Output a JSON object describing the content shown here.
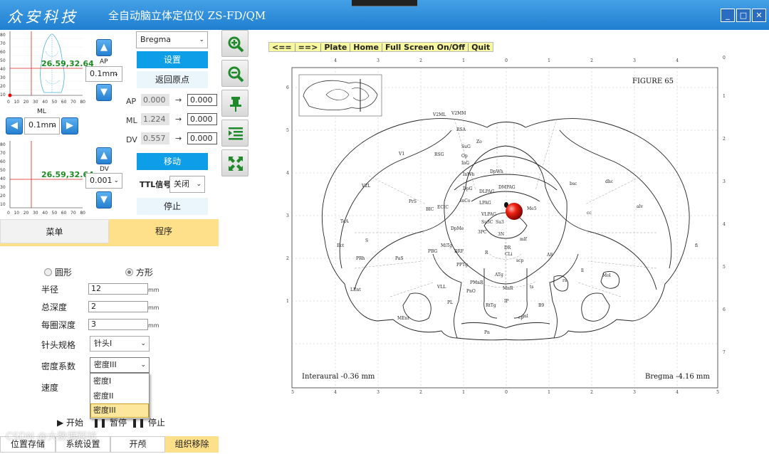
{
  "window": {
    "brand": "众安科技",
    "title": "全自动脑立体定位仪 ZS-FD/QM",
    "controls": {
      "minimize": "_",
      "maximize": "□",
      "close": "✕"
    }
  },
  "plot_top": {
    "coord": "26.59,32.64",
    "xlabel": "ML",
    "yticks": [
      "80",
      "70",
      "60",
      "50",
      "40",
      "30",
      "20",
      "10",
      "0"
    ],
    "xticks": [
      "0",
      "10",
      "20",
      "30",
      "40",
      "50",
      "60",
      "70",
      "80"
    ]
  },
  "plot_bottom": {
    "coord": "26.59,32.64",
    "yticks": [
      "80",
      "70",
      "60",
      "50",
      "40",
      "30",
      "20",
      "10",
      "0"
    ],
    "xticks": [
      "0",
      "10",
      "20",
      "30",
      "40",
      "50",
      "60",
      "70",
      "80"
    ]
  },
  "ap": {
    "label": "AP",
    "step": "0.1mm"
  },
  "ml": {
    "step": "0.1mm"
  },
  "dv": {
    "label": "DV",
    "step": "0.001"
  },
  "reference": {
    "value": "Bregma"
  },
  "buttons": {
    "set": "设置",
    "return_origin": "返回原点",
    "move": "移动",
    "stop": "停止"
  },
  "coords": [
    {
      "label": "AP",
      "current": "0.000",
      "target": "0.000"
    },
    {
      "label": "ML",
      "current": "1.224",
      "target": "0.000"
    },
    {
      "label": "DV",
      "current": "0.557",
      "target": "0.000"
    }
  ],
  "arrow": "→",
  "ttl": {
    "label": "TTL信号",
    "value": "关闭"
  },
  "tabs": {
    "menu": "菜单",
    "program": "程序"
  },
  "program": {
    "shape_circle": "圆形",
    "shape_square": "方形",
    "selected_shape": "方形",
    "radius_label": "半径",
    "radius": "12",
    "total_depth_label": "总深度",
    "total_depth": "2",
    "per_depth_label": "每圈深度",
    "per_depth": "3",
    "unit": "mm",
    "needle_label": "针头规格",
    "needle": "针头I",
    "density_label": "密度系数",
    "density": "密度III",
    "density_options": [
      "密度I",
      "密度II",
      "密度III"
    ],
    "speed_label": "速度",
    "start": "▶ 开始",
    "pause": "暂停",
    "stop": "停止"
  },
  "bottom_tabs": [
    "位置存储",
    "系统设置",
    "开颅",
    "组织移除"
  ],
  "watermark": "CSDN @大数据踩坑",
  "atlas": {
    "nav": [
      "<==",
      "==>",
      "Plate",
      "Home",
      "Full Screen On/Off",
      "Quit"
    ],
    "figure": "FIGURE 65",
    "interaural": "Interaural -0.36 mm",
    "bregma": "Bregma -4.16 mm",
    "top_ticks": [
      "4",
      "3",
      "2",
      "1",
      "0",
      "1",
      "2",
      "3",
      "4"
    ],
    "bottom_ticks": [
      "5",
      "4",
      "3",
      "2",
      "1",
      "0",
      "1",
      "2",
      "3",
      "4",
      "5"
    ],
    "left_ticks": [
      "6",
      "5",
      "4",
      "3",
      "2",
      "1"
    ],
    "right_ticks": [
      "0",
      "1",
      "2",
      "3",
      "4",
      "5",
      "6",
      "7"
    ],
    "regions": [
      "V2ML",
      "V2MM",
      "RSA",
      "Zo",
      "SuG",
      "Op",
      "InG",
      "InWh",
      "DpWh",
      "DpG",
      "DLPAG",
      "DMPAG",
      "LPAG",
      "VLPAG",
      "Su3C",
      "Su3",
      "3PC",
      "3N",
      "mlf",
      "InCo",
      "ECIC",
      "BIC",
      "PrS",
      "V1",
      "RSG",
      "V2L",
      "TeA",
      "Ect",
      "S",
      "PaS",
      "PRh",
      "LEnt",
      "MEnt",
      "DpMe",
      "MiTg",
      "PBG",
      "RRF",
      "PPTg",
      "R",
      "CLi",
      "DR",
      "scp",
      "A8",
      "VLL",
      "PnO",
      "PMnR",
      "MnR",
      "PL",
      "RtTg",
      "ATg",
      "IP",
      "B9",
      "ml",
      "cp",
      "ts",
      "Pn",
      "rs",
      "ll",
      "Mol",
      "fi",
      "alv",
      "cc",
      "dhc",
      "bsc",
      "Me5"
    ]
  }
}
